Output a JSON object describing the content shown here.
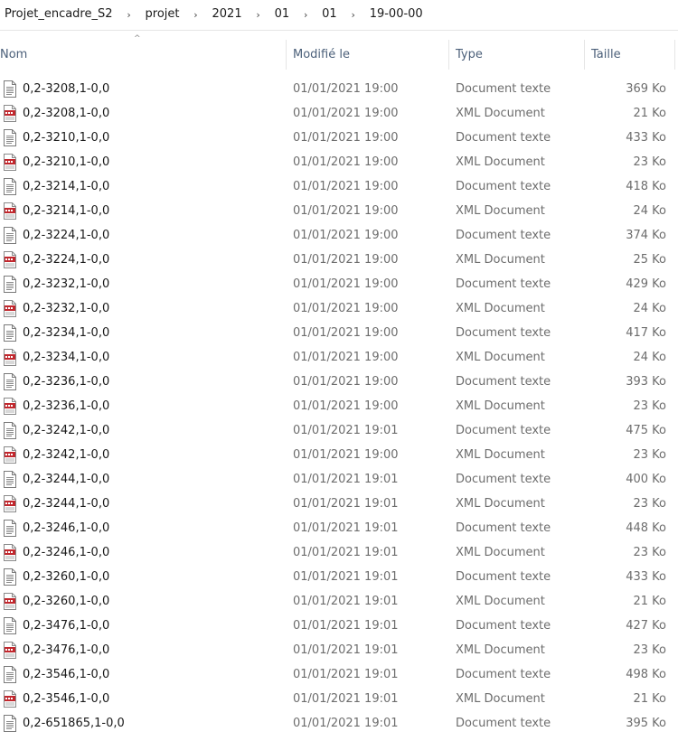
{
  "breadcrumb": {
    "items": [
      "Projet_encadre_S2",
      "projet",
      "2021",
      "01",
      "01",
      "19-00-00"
    ],
    "separator": "›"
  },
  "columns": {
    "name": "Nom",
    "modified": "Modifié le",
    "type": "Type",
    "size": "Taille"
  },
  "files": [
    {
      "name": "0,2-3208,1-0,0",
      "modified": "01/01/2021 19:00",
      "type": "Document texte",
      "size": "369 Ko",
      "icon": "text-file-icon"
    },
    {
      "name": "0,2-3208,1-0,0",
      "modified": "01/01/2021 19:00",
      "type": "XML Document",
      "size": "21 Ko",
      "icon": "xml-file-icon"
    },
    {
      "name": "0,2-3210,1-0,0",
      "modified": "01/01/2021 19:00",
      "type": "Document texte",
      "size": "433 Ko",
      "icon": "text-file-icon"
    },
    {
      "name": "0,2-3210,1-0,0",
      "modified": "01/01/2021 19:00",
      "type": "XML Document",
      "size": "23 Ko",
      "icon": "xml-file-icon"
    },
    {
      "name": "0,2-3214,1-0,0",
      "modified": "01/01/2021 19:00",
      "type": "Document texte",
      "size": "418 Ko",
      "icon": "text-file-icon"
    },
    {
      "name": "0,2-3214,1-0,0",
      "modified": "01/01/2021 19:00",
      "type": "XML Document",
      "size": "24 Ko",
      "icon": "xml-file-icon"
    },
    {
      "name": "0,2-3224,1-0,0",
      "modified": "01/01/2021 19:00",
      "type": "Document texte",
      "size": "374 Ko",
      "icon": "text-file-icon"
    },
    {
      "name": "0,2-3224,1-0,0",
      "modified": "01/01/2021 19:00",
      "type": "XML Document",
      "size": "25 Ko",
      "icon": "xml-file-icon"
    },
    {
      "name": "0,2-3232,1-0,0",
      "modified": "01/01/2021 19:00",
      "type": "Document texte",
      "size": "429 Ko",
      "icon": "text-file-icon"
    },
    {
      "name": "0,2-3232,1-0,0",
      "modified": "01/01/2021 19:00",
      "type": "XML Document",
      "size": "24 Ko",
      "icon": "xml-file-icon"
    },
    {
      "name": "0,2-3234,1-0,0",
      "modified": "01/01/2021 19:00",
      "type": "Document texte",
      "size": "417 Ko",
      "icon": "text-file-icon"
    },
    {
      "name": "0,2-3234,1-0,0",
      "modified": "01/01/2021 19:00",
      "type": "XML Document",
      "size": "24 Ko",
      "icon": "xml-file-icon"
    },
    {
      "name": "0,2-3236,1-0,0",
      "modified": "01/01/2021 19:00",
      "type": "Document texte",
      "size": "393 Ko",
      "icon": "text-file-icon"
    },
    {
      "name": "0,2-3236,1-0,0",
      "modified": "01/01/2021 19:00",
      "type": "XML Document",
      "size": "23 Ko",
      "icon": "xml-file-icon"
    },
    {
      "name": "0,2-3242,1-0,0",
      "modified": "01/01/2021 19:01",
      "type": "Document texte",
      "size": "475 Ko",
      "icon": "text-file-icon"
    },
    {
      "name": "0,2-3242,1-0,0",
      "modified": "01/01/2021 19:00",
      "type": "XML Document",
      "size": "23 Ko",
      "icon": "xml-file-icon"
    },
    {
      "name": "0,2-3244,1-0,0",
      "modified": "01/01/2021 19:01",
      "type": "Document texte",
      "size": "400 Ko",
      "icon": "text-file-icon"
    },
    {
      "name": "0,2-3244,1-0,0",
      "modified": "01/01/2021 19:01",
      "type": "XML Document",
      "size": "23 Ko",
      "icon": "xml-file-icon"
    },
    {
      "name": "0,2-3246,1-0,0",
      "modified": "01/01/2021 19:01",
      "type": "Document texte",
      "size": "448 Ko",
      "icon": "text-file-icon"
    },
    {
      "name": "0,2-3246,1-0,0",
      "modified": "01/01/2021 19:01",
      "type": "XML Document",
      "size": "23 Ko",
      "icon": "xml-file-icon"
    },
    {
      "name": "0,2-3260,1-0,0",
      "modified": "01/01/2021 19:01",
      "type": "Document texte",
      "size": "433 Ko",
      "icon": "text-file-icon"
    },
    {
      "name": "0,2-3260,1-0,0",
      "modified": "01/01/2021 19:01",
      "type": "XML Document",
      "size": "21 Ko",
      "icon": "xml-file-icon"
    },
    {
      "name": "0,2-3476,1-0,0",
      "modified": "01/01/2021 19:01",
      "type": "Document texte",
      "size": "427 Ko",
      "icon": "text-file-icon"
    },
    {
      "name": "0,2-3476,1-0,0",
      "modified": "01/01/2021 19:01",
      "type": "XML Document",
      "size": "23 Ko",
      "icon": "xml-file-icon"
    },
    {
      "name": "0,2-3546,1-0,0",
      "modified": "01/01/2021 19:01",
      "type": "Document texte",
      "size": "498 Ko",
      "icon": "text-file-icon"
    },
    {
      "name": "0,2-3546,1-0,0",
      "modified": "01/01/2021 19:01",
      "type": "XML Document",
      "size": "21 Ko",
      "icon": "xml-file-icon"
    },
    {
      "name": "0,2-651865,1-0,0",
      "modified": "01/01/2021 19:01",
      "type": "Document texte",
      "size": "395 Ko",
      "icon": "text-file-icon"
    }
  ]
}
